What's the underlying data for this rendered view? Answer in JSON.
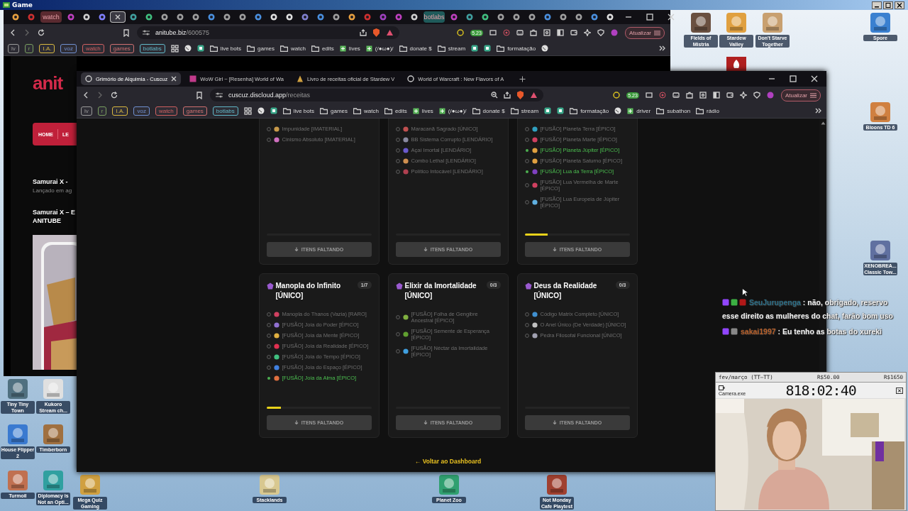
{
  "desktop": {
    "title": "Game",
    "icons": [
      {
        "label": "Fields of Mistria"
      },
      {
        "label": "Stardew Valley"
      },
      {
        "label": "Don't Starve Together"
      },
      {
        "label": "Spore"
      },
      {
        "label": "Bloons TD 6"
      },
      {
        "label": "XENOBREA... Classic Tow..."
      },
      {
        "label": "Tiny Tiny Town"
      },
      {
        "label": "Kukoro Stream ch..."
      },
      {
        "label": "House Flipper 2"
      },
      {
        "label": "Timberborn"
      },
      {
        "label": "Turmoil"
      },
      {
        "label": "Diplomacy is Not an Opti..."
      },
      {
        "label": "Mega Quiz Gaming"
      },
      {
        "label": "Stacklands"
      },
      {
        "label": "Planet Zoo"
      },
      {
        "label": "Not Monday Cafe Playtest"
      }
    ]
  },
  "back_window": {
    "tabs": [
      {
        "kind": "icon",
        "selected": false
      },
      {
        "kind": "icon",
        "selected": false
      },
      {
        "kind": "label",
        "label": "watch",
        "color": "#5a2a30",
        "selected": false
      },
      {
        "kind": "icon",
        "selected": false
      },
      {
        "kind": "icon",
        "selected": false
      },
      {
        "kind": "icon",
        "selected": false
      },
      {
        "kind": "icon",
        "selected": true
      },
      {
        "kind": "icon",
        "selected": false
      },
      {
        "kind": "icon",
        "selected": false
      },
      {
        "kind": "icon",
        "selected": false
      },
      {
        "kind": "icon",
        "selected": false
      },
      {
        "kind": "icon",
        "selected": false
      },
      {
        "kind": "icon",
        "selected": false
      },
      {
        "kind": "icon",
        "selected": false
      },
      {
        "kind": "icon",
        "selected": false
      },
      {
        "kind": "icon",
        "selected": false
      },
      {
        "kind": "icon",
        "selected": false
      },
      {
        "kind": "icon",
        "selected": false
      },
      {
        "kind": "icon",
        "selected": false
      },
      {
        "kind": "icon",
        "selected": false
      },
      {
        "kind": "icon",
        "selected": false
      },
      {
        "kind": "icon",
        "selected": false
      },
      {
        "kind": "icon",
        "selected": false
      },
      {
        "kind": "icon",
        "selected": false
      },
      {
        "kind": "icon",
        "selected": false
      },
      {
        "kind": "icon",
        "selected": false
      },
      {
        "kind": "label",
        "label": "botlabs",
        "color": "#1f5a5a",
        "selected": false
      },
      {
        "kind": "icon",
        "selected": false
      },
      {
        "kind": "icon",
        "selected": false
      },
      {
        "kind": "icon",
        "selected": false
      },
      {
        "kind": "icon",
        "selected": false
      },
      {
        "kind": "icon",
        "selected": false
      },
      {
        "kind": "icon",
        "selected": false
      },
      {
        "kind": "icon",
        "selected": false
      },
      {
        "kind": "icon",
        "selected": false
      },
      {
        "kind": "icon",
        "selected": false
      },
      {
        "kind": "icon",
        "selected": false
      },
      {
        "kind": "icon",
        "selected": false
      }
    ],
    "address": {
      "host": "anitube.biz",
      "path": "/600575"
    },
    "badge": "5.23",
    "update_button": "Atualizar",
    "bookmarks": [
      {
        "kind": "tag",
        "label": "lv",
        "color": "#9a9a9a"
      },
      {
        "kind": "tag",
        "label": "r",
        "color": "#7aa060"
      },
      {
        "kind": "tag",
        "label": "I.A.",
        "color": "#d8b840"
      },
      {
        "kind": "tag",
        "label": "voz",
        "color": "#7090d0"
      },
      {
        "kind": "tag",
        "label": "watch",
        "color": "#d06060"
      },
      {
        "kind": "tag",
        "label": "games",
        "color": "#d07070"
      },
      {
        "kind": "tag",
        "label": "botlabs",
        "color": "#60b8c8"
      },
      {
        "kind": "grid"
      },
      {
        "kind": "globe"
      },
      {
        "kind": "app"
      },
      {
        "kind": "folder",
        "label": "live bots"
      },
      {
        "kind": "folder",
        "label": "games"
      },
      {
        "kind": "folder",
        "label": "watch"
      },
      {
        "kind": "folder",
        "label": "edits"
      },
      {
        "kind": "page",
        "label": "lives"
      },
      {
        "kind": "page",
        "label": "(/●ω●)/"
      },
      {
        "kind": "folder",
        "label": "donate $"
      },
      {
        "kind": "folder",
        "label": "stream"
      },
      {
        "kind": "app"
      },
      {
        "kind": "app"
      },
      {
        "kind": "folder",
        "label": "formatação"
      },
      {
        "kind": "globe"
      }
    ],
    "page": {
      "logo": "anit",
      "nav": [
        "HOME",
        "LE"
      ],
      "headline": "Samurai X -",
      "subline": "Lançado em ag",
      "post_title": [
        "Samurai X – E",
        "ANITUBE"
      ]
    }
  },
  "front_window": {
    "tabs": [
      {
        "label": "Grimório de Alquimia - Cuscuz",
        "selected": true
      },
      {
        "label": "WoW Girl ~ [Resenha] World of Wa",
        "selected": false
      },
      {
        "label": "Livro de receitas oficial de Stardew V",
        "selected": false
      },
      {
        "label": "World of Warcraft : New Flavors of A",
        "selected": false
      }
    ],
    "address": {
      "host": "cuscuz.discloud.app",
      "path": "/receitas"
    },
    "badge": "5.23",
    "update_button": "Atualizar",
    "bookmarks": [
      {
        "kind": "tag",
        "label": "lv",
        "color": "#9a9a9a"
      },
      {
        "kind": "tag",
        "label": "r",
        "color": "#7aa060"
      },
      {
        "kind": "tag",
        "label": "I.A.",
        "color": "#d8b840"
      },
      {
        "kind": "tag",
        "label": "voz",
        "color": "#7090d0"
      },
      {
        "kind": "tag",
        "label": "watch",
        "color": "#d06060"
      },
      {
        "kind": "tag",
        "label": "games",
        "color": "#d07070"
      },
      {
        "kind": "tag",
        "label": "botlabs",
        "color": "#60b8c8"
      },
      {
        "kind": "grid"
      },
      {
        "kind": "globe"
      },
      {
        "kind": "app"
      },
      {
        "kind": "folder",
        "label": "live bots"
      },
      {
        "kind": "folder",
        "label": "games"
      },
      {
        "kind": "folder",
        "label": "watch"
      },
      {
        "kind": "folder",
        "label": "edits"
      },
      {
        "kind": "page",
        "label": "lives"
      },
      {
        "kind": "page",
        "label": "(/●ω●)/"
      },
      {
        "kind": "folder",
        "label": "donate $"
      },
      {
        "kind": "folder",
        "label": "stream"
      },
      {
        "kind": "app"
      },
      {
        "kind": "app"
      },
      {
        "kind": "folder",
        "label": "formatação"
      },
      {
        "kind": "globe"
      },
      {
        "kind": "page",
        "label": "driver"
      },
      {
        "kind": "folder",
        "label": "subathon"
      },
      {
        "kind": "folder",
        "label": "rádio"
      }
    ],
    "rows": [
      {
        "cards": [
          {
            "items": [
              {
                "label": "Impunidade [IMATERIAL]",
                "color": "#c89a4a",
                "checked": false
              },
              {
                "label": "Cinismo Absoluto [IMATERIAL]",
                "color": "#d070c0",
                "checked": false
              }
            ],
            "level": 0,
            "button": "ITENS FALTANDO"
          },
          {
            "items": [
              {
                "label": "Maracanã Sagrado [ÚNICO]",
                "color": "#c05050",
                "checked": false
              },
              {
                "label": "BB Sistema Corrupto [LENDÁRIO]",
                "color": "#8a8aa0",
                "checked": false
              },
              {
                "label": "Açaí Imortal [LENDÁRIO]",
                "color": "#6a5acd",
                "checked": false
              },
              {
                "label": "Combo Lethal [LENDÁRIO]",
                "color": "#d09050",
                "checked": false
              },
              {
                "label": "Político Intocável [LENDÁRIO]",
                "color": "#b04050",
                "checked": false
              }
            ],
            "level": 0,
            "button": "ITENS FALTANDO"
          },
          {
            "items": [
              {
                "label": "[FUSÃO] Planeta Terra [ÉPICO]",
                "color": "#30a0c0",
                "checked": false
              },
              {
                "label": "[FUSÃO] Planeta Marte [ÉPICO]",
                "color": "#d04060",
                "checked": false
              },
              {
                "label": "[FUSÃO] Planeta Júpiter [ÉPICO]",
                "color": "#e0a040",
                "checked": true
              },
              {
                "label": "[FUSÃO] Planeta Saturno [ÉPICO]",
                "color": "#e0a040",
                "checked": false
              },
              {
                "label": "[FUSÃO] Lua da Terra [ÉPICO]",
                "color": "#8040c0",
                "checked": true
              },
              {
                "label": "[FUSÃO] Lua Vermelha de Marte [ÉPICO]",
                "color": "#d04060",
                "checked": false
              },
              {
                "label": "[FUSÃO] Lua Europeia de Júpiter [ÉPICO]",
                "color": "#60b0e0",
                "checked": false
              }
            ],
            "level": 0.22,
            "button": "ITENS FALTANDO"
          }
        ]
      },
      {
        "cards": [
          {
            "title": "Manopla do Infinito [ÚNICO]",
            "badge": "1/7",
            "items": [
              {
                "label": "Manopla do Thanos (Vazia) [RARO]",
                "color": "#d04060",
                "checked": false
              },
              {
                "label": "[FUSÃO] Joia do Poder [ÉPICO]",
                "color": "#9070d0",
                "checked": false
              },
              {
                "label": "[FUSÃO] Joia da Mente [ÉPICO]",
                "color": "#e0b040",
                "checked": false
              },
              {
                "label": "[FUSÃO] Joia da Realidade [ÉPICO]",
                "color": "#e03050",
                "checked": false
              },
              {
                "label": "[FUSÃO] Joia do Tempo [ÉPICO]",
                "color": "#40c080",
                "checked": false
              },
              {
                "label": "[FUSÃO] Joia do Espaço [ÉPICO]",
                "color": "#4080e0",
                "checked": false
              },
              {
                "label": "[FUSÃO] Joia da Alma [ÉPICO]",
                "color": "#e07040",
                "checked": true
              }
            ],
            "level": 0.14,
            "button": "ITENS FALTANDO"
          },
          {
            "title": "Elixir da Imortalidade [ÚNICO]",
            "badge": "0/3",
            "items": [
              {
                "label": "[FUSÃO] Folha de Gengibre Ancestral [ÉPICO]",
                "color": "#80b040",
                "checked": false
              },
              {
                "label": "[FUSÃO] Semente de Esperança [ÉPICO]",
                "color": "#60a030",
                "checked": false
              },
              {
                "label": "[FUSÃO] Néctar da Imortalidade [ÉPICO]",
                "color": "#40a0e0",
                "checked": false
              }
            ],
            "level": 0,
            "button": "ITENS FALTANDO"
          },
          {
            "title": "Deus da Realidade [ÚNICO]",
            "badge": "0/3",
            "items": [
              {
                "label": "Código Matrix Completo [ÚNICO]",
                "color": "#4090d0",
                "checked": false
              },
              {
                "label": "O Anel Único (De Verdade) [ÚNICO]",
                "color": "#c0c0c0",
                "checked": false
              },
              {
                "label": "Pedra Filosofal Funcional [ÚNICO]",
                "color": "#a0a0b0",
                "checked": false
              }
            ],
            "level": 0,
            "button": "ITENS FALTANDO"
          }
        ]
      }
    ],
    "back_link": "← Voltar ao Dashboard"
  },
  "chat": [
    {
      "user": "SeuJurupenga",
      "color": "#2d6e86",
      "text": ": não, obrigado, reservo esse direito as mulheres do chat, farão bom uso"
    },
    {
      "user": "sakai1997",
      "color": "#b8602a",
      "text": ": Eu tenho as botas do xureki"
    }
  ],
  "webcam": {
    "caption": "fev/março (TT—TT)",
    "goal_current": "R$50.00",
    "goal_target": "R$1650",
    "window_title": "Camera.exe",
    "timer": "818:02:40"
  }
}
